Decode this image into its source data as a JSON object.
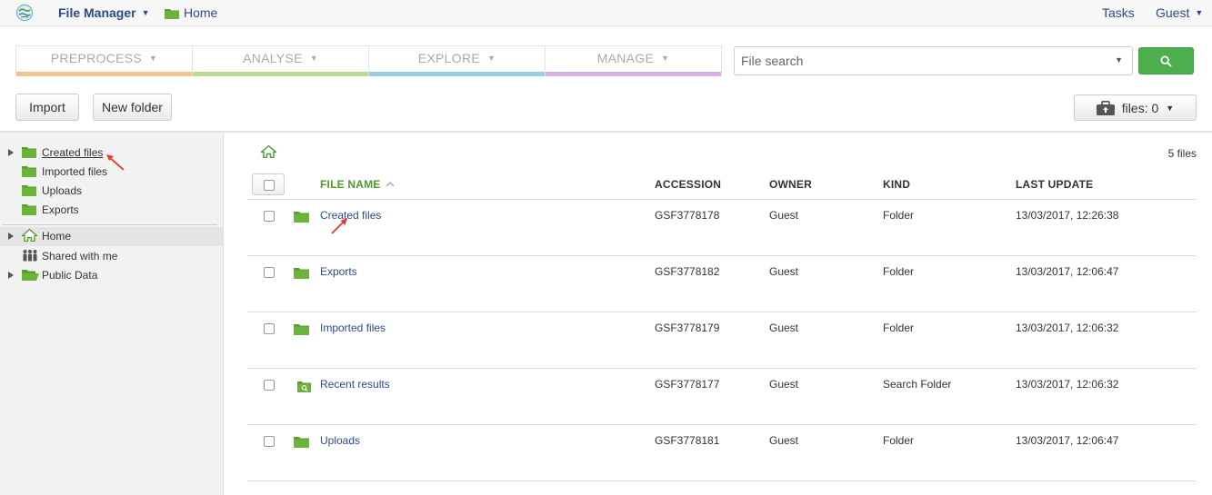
{
  "topbar": {
    "app_title": "File Manager",
    "breadcrumb_home": "Home",
    "tasks": "Tasks",
    "user": "Guest"
  },
  "workflow_tabs": [
    {
      "label": "PREPROCESS",
      "color": "#f0c490"
    },
    {
      "label": "ANALYSE",
      "color": "#b9dc95"
    },
    {
      "label": "EXPLORE",
      "color": "#9ccbe6"
    },
    {
      "label": "MANAGE",
      "color": "#d7b0e5"
    }
  ],
  "search": {
    "placeholder": "File search",
    "button_icon": "search-icon"
  },
  "toolbar": {
    "import_label": "Import",
    "new_folder_label": "New folder",
    "files_label": "files: 0"
  },
  "sidebar": {
    "items": [
      {
        "label": "Created files",
        "icon": "folder-icon",
        "expandable": true
      },
      {
        "label": "Imported files",
        "icon": "folder-icon",
        "expandable": false
      },
      {
        "label": "Uploads",
        "icon": "folder-icon",
        "expandable": false
      },
      {
        "label": "Exports",
        "icon": "folder-icon",
        "expandable": false
      },
      {
        "label": "Home",
        "icon": "home-icon",
        "expandable": true,
        "active": true
      },
      {
        "label": "Shared with me",
        "icon": "people-icon",
        "expandable": false
      },
      {
        "label": "Public Data",
        "icon": "open-folder-icon",
        "expandable": true
      }
    ]
  },
  "main": {
    "file_count": "5 files",
    "columns": {
      "name": "FILE NAME",
      "accession": "ACCESSION",
      "owner": "OWNER",
      "kind": "KIND",
      "last_update": "LAST UPDATE"
    },
    "rows": [
      {
        "name": "Created files",
        "accession": "GSF3778178",
        "owner": "Guest",
        "kind": "Folder",
        "last_update": "13/03/2017, 12:26:38",
        "icon": "folder-icon"
      },
      {
        "name": "Exports",
        "accession": "GSF3778182",
        "owner": "Guest",
        "kind": "Folder",
        "last_update": "13/03/2017, 12:06:47",
        "icon": "folder-icon"
      },
      {
        "name": "Imported files",
        "accession": "GSF3778179",
        "owner": "Guest",
        "kind": "Folder",
        "last_update": "13/03/2017, 12:06:32",
        "icon": "folder-icon"
      },
      {
        "name": "Recent results",
        "accession": "GSF3778177",
        "owner": "Guest",
        "kind": "Search Folder",
        "last_update": "13/03/2017, 12:06:32",
        "icon": "search-folder-icon"
      },
      {
        "name": "Uploads",
        "accession": "GSF3778181",
        "owner": "Guest",
        "kind": "Folder",
        "last_update": "13/03/2017, 12:06:47",
        "icon": "folder-icon"
      }
    ]
  },
  "colors": {
    "link": "#2b4a8a",
    "accent_green": "#4cae4c",
    "folder_green": "#5b9f2b",
    "annotation_red": "#e8392c"
  }
}
